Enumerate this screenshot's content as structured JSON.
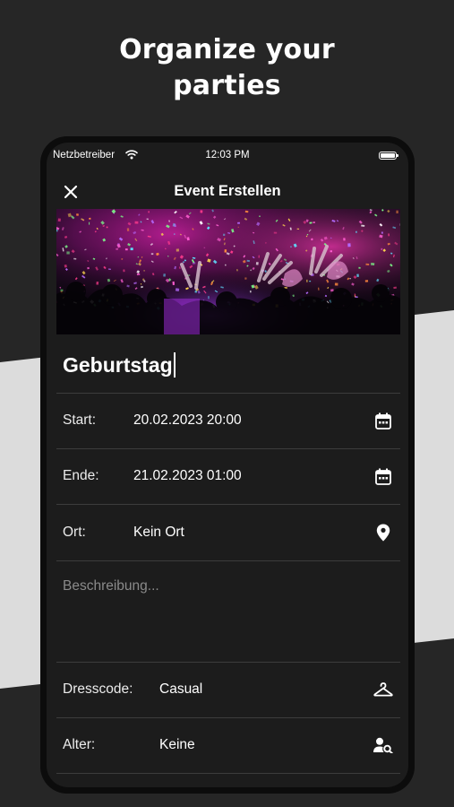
{
  "promo": {
    "line1": "Organize your",
    "line2": "parties"
  },
  "statusbar": {
    "carrier": "Netzbetreiber",
    "time": "12:03 PM"
  },
  "navbar": {
    "title": "Event Erstellen",
    "close_icon": "close-icon"
  },
  "event": {
    "name": "Geburtstag"
  },
  "fields": {
    "start": {
      "label": "Start:",
      "value": "20.02.2023 20:00",
      "icon": "calendar-icon"
    },
    "end": {
      "label": "Ende:",
      "value": "21.02.2023 01:00",
      "icon": "calendar-icon"
    },
    "location": {
      "label": "Ort:",
      "value": "Kein Ort",
      "icon": "location-pin-icon"
    },
    "description": {
      "placeholder": "Beschreibung..."
    },
    "dresscode": {
      "label": "Dresscode:",
      "value": "Casual",
      "icon": "hanger-icon"
    },
    "age": {
      "label": "Alter:",
      "value": "Keine",
      "icon": "person-search-icon"
    }
  },
  "colors": {
    "background": "#262626",
    "stripe": "#dcdcdc",
    "screen": "#1c1c1c",
    "divider": "#3c3c3c",
    "text": "#ffffff",
    "placeholder": "#8a8a8a"
  }
}
